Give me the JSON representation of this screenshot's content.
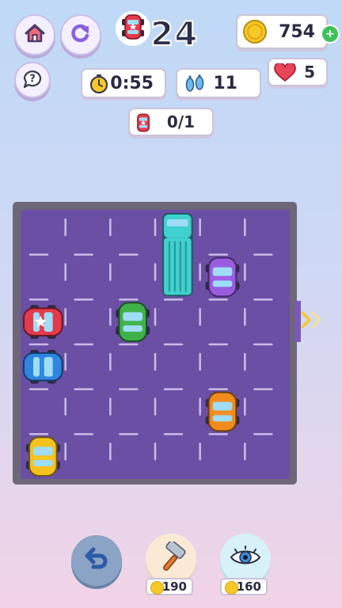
{
  "level": {
    "number": "24"
  },
  "stats": {
    "coins": "754",
    "lives": "5",
    "timer": "0:55",
    "moves": "11",
    "target_progress": "0/1"
  },
  "boosters": [
    {
      "name": "hammer",
      "price": "190"
    },
    {
      "name": "eye",
      "price": "160"
    }
  ],
  "board": {
    "columns": 6,
    "rows": 6,
    "vehicles": [
      {
        "kind": "truck",
        "color": "#3fd0d0",
        "col": 3,
        "row": 0,
        "orientation": "vertical",
        "length": 2
      },
      {
        "kind": "car",
        "color": "#9a5de0",
        "col": 4,
        "row": 1,
        "orientation": "vertical",
        "length": 1
      },
      {
        "kind": "car-target",
        "color": "#e43a4c",
        "col": 0,
        "row": 2,
        "orientation": "horizontal",
        "length": 1
      },
      {
        "kind": "car",
        "color": "#3fb14a",
        "col": 2,
        "row": 2,
        "orientation": "vertical",
        "length": 1
      },
      {
        "kind": "car",
        "color": "#2e86e0",
        "col": 0,
        "row": 3,
        "orientation": "horizontal",
        "length": 1
      },
      {
        "kind": "car",
        "color": "#f28b1e",
        "col": 4,
        "row": 4,
        "orientation": "vertical",
        "length": 1
      },
      {
        "kind": "car",
        "color": "#f4c21d",
        "col": 0,
        "row": 5,
        "orientation": "vertical",
        "length": 1
      }
    ]
  },
  "colors": {
    "board": "#6a4fa5",
    "frame": "#6d6777",
    "exit_arrow": "#f7c928",
    "heart": "#e8445a",
    "coin": "#f7c928"
  },
  "icons": {
    "home": "home-icon",
    "restart": "restart-icon",
    "help": "help-icon",
    "stopwatch": "stopwatch-icon",
    "footprints": "footprints-icon",
    "heart": "heart-icon",
    "coin": "coin-icon",
    "undo": "undo-icon",
    "hammer": "hammer-icon",
    "eye": "eye-icon"
  }
}
